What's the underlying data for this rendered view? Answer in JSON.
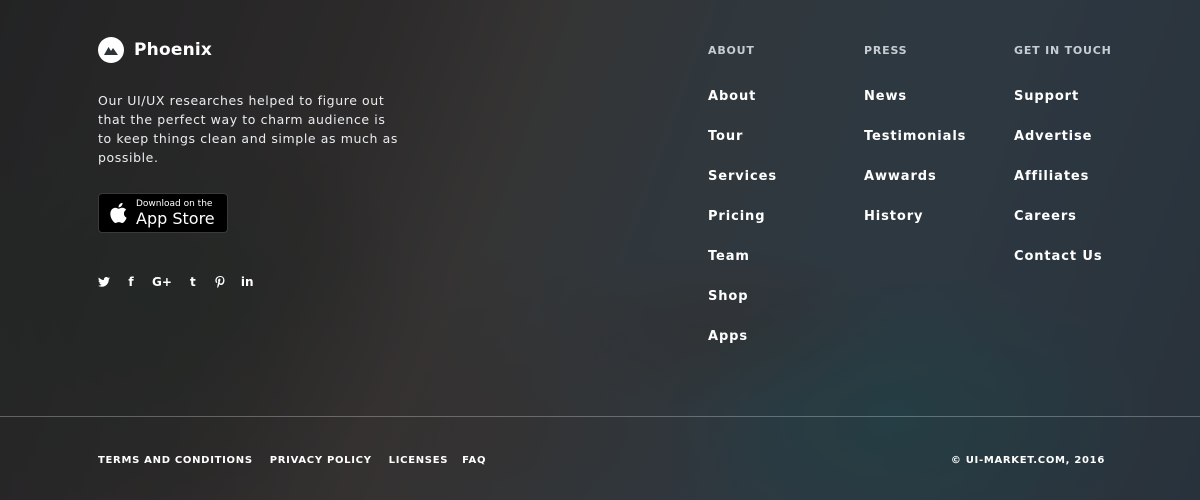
{
  "brand": {
    "name": "Phoenix",
    "logo_icon": "mountain-logo-icon"
  },
  "about_text": "Our UI/UX researches helped to figure out that the perfect way to charm audience is to keep things clean and simple as much as possible.",
  "app_store": {
    "small": "Download on the",
    "big": "App Store"
  },
  "social": [
    {
      "name": "twitter-icon"
    },
    {
      "name": "facebook-icon",
      "glyph": "f"
    },
    {
      "name": "google-plus-icon",
      "glyph": "G+"
    },
    {
      "name": "tumblr-icon",
      "glyph": "t"
    },
    {
      "name": "pinterest-icon"
    },
    {
      "name": "linkedin-icon",
      "glyph": "in"
    }
  ],
  "columns": [
    {
      "heading": "ABOUT",
      "links": [
        "About",
        "Tour",
        "Services",
        "Pricing",
        "Team",
        "Shop",
        "Apps"
      ]
    },
    {
      "heading": "PRESS",
      "links": [
        "News",
        "Testimonials",
        "Awwards",
        "History"
      ]
    },
    {
      "heading": "GET IN TOUCH",
      "links": [
        "Support",
        "Advertise",
        "Affiliates",
        "Careers",
        "Contact Us"
      ]
    }
  ],
  "bottom": {
    "links": [
      "TERMS AND CONDITIONS",
      "PRIVACY POLICY",
      "LICENSES",
      "FAQ"
    ],
    "copyright": "© UI-MARKET.COM, 2016"
  }
}
